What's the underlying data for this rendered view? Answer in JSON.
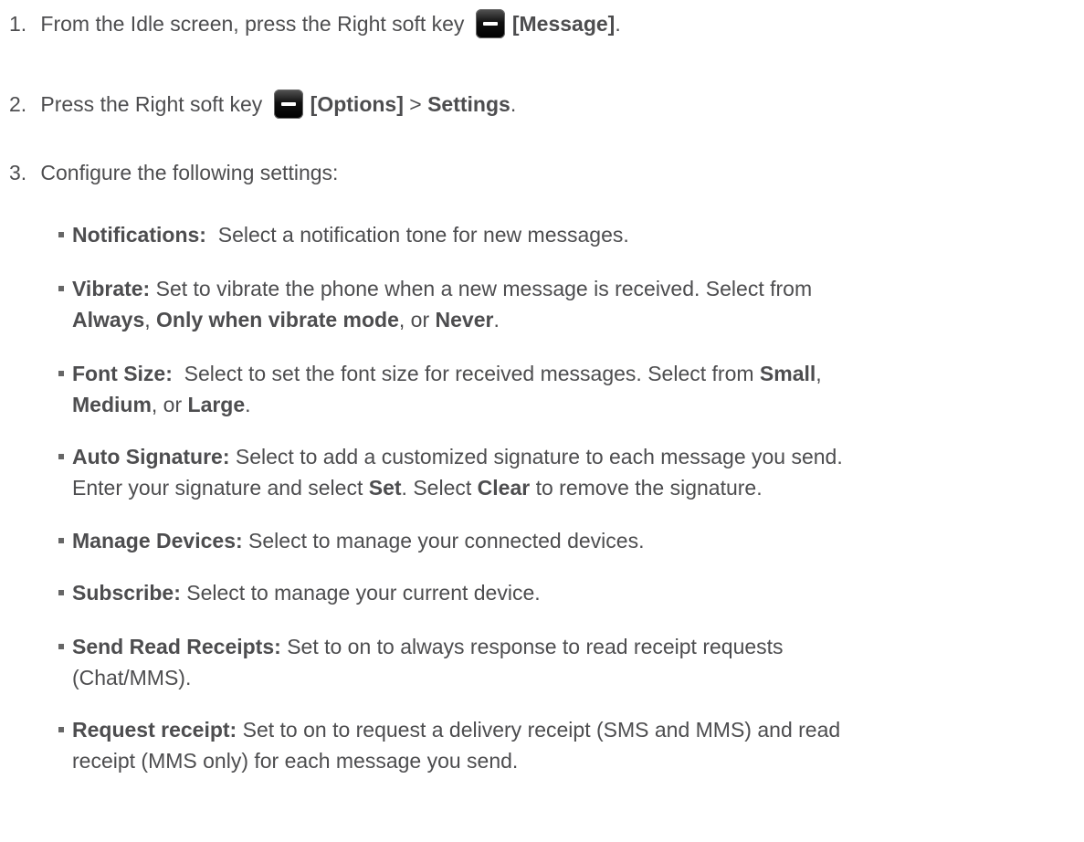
{
  "steps": [
    {
      "num": "1.",
      "pre": "From the Idle screen, press the Right soft key",
      "key_icon": "right-soft-key-icon",
      "bold": "[Message]",
      "post": "."
    },
    {
      "num": "2.",
      "pre": "Press the Right soft key",
      "key_icon": "right-soft-key-icon",
      "bold": "[Options]",
      "mid": ">",
      "bold2": "Settings",
      "post": "."
    },
    {
      "num": "3.",
      "text": "Configure the following settings:"
    }
  ],
  "settings": [
    {
      "label": "Notifications:",
      "desc": "Select a notification tone for new messages."
    },
    {
      "label": "Vibrate:",
      "desc": "Set to vibrate the phone when a new message is received. Select from",
      "line2": [
        {
          "b": "Always"
        },
        {
          "t": ", "
        },
        {
          "b": "Only when vibrate mode"
        },
        {
          "t": ", or "
        },
        {
          "b": "Never"
        },
        {
          "t": "."
        }
      ]
    },
    {
      "label": "Font Size:",
      "desc": "Select to set the font size for received messages. Select from",
      "tail_bold": "Small",
      "tail": ",",
      "line2": [
        {
          "b": "Medium"
        },
        {
          "t": ", or "
        },
        {
          "b": "Large"
        },
        {
          "t": "."
        }
      ]
    },
    {
      "label": "Auto Signature:",
      "desc": "Select to add a customized signature to each message you send.",
      "line2": [
        {
          "t": "Enter your signature and select "
        },
        {
          "b": "Set"
        },
        {
          "t": ". Select "
        },
        {
          "b": "Clear"
        },
        {
          "t": " to remove the signature."
        }
      ]
    },
    {
      "label": "Manage Devices:",
      "desc": "Select to manage your connected devices."
    },
    {
      "label": "Subscribe:",
      "desc": "Select to manage your current device."
    },
    {
      "label": "Send Read Receipts:",
      "desc": "Set to on to always response to read receipt requests",
      "line2": [
        {
          "t": "(Chat/MMS)."
        }
      ]
    },
    {
      "label": "Request receipt:",
      "desc": "Set to on to request a delivery receipt (SMS and MMS) and read",
      "line2": [
        {
          "t": "receipt (MMS only) for each message you send."
        }
      ]
    }
  ]
}
